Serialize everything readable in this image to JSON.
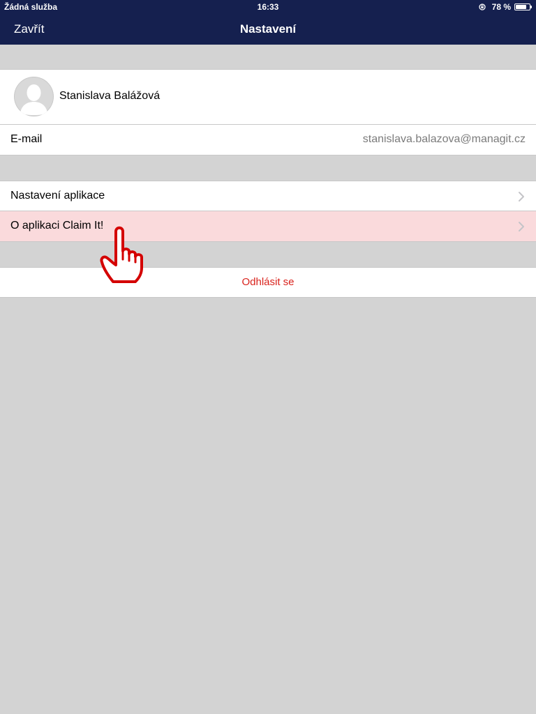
{
  "status_bar": {
    "carrier": "Žádná služba",
    "time": "16:33",
    "battery_percent": "78 %",
    "battery_level": 0.78
  },
  "nav_bar": {
    "close_label": "Zavřít",
    "title": "Nastavení"
  },
  "profile": {
    "name": "Stanislava Balážová",
    "avatar_icon": "person-silhouette-icon"
  },
  "email": {
    "label": "E-mail",
    "value": "stanislava.balazova@managit.cz"
  },
  "menu": {
    "app_settings_label": "Nastavení aplikace",
    "about_label": "O aplikaci Claim It!"
  },
  "logout": {
    "label": "Odhlásit se"
  },
  "colors": {
    "nav_background": "#15204f",
    "page_background": "#d3d3d3",
    "highlight_row": "#fadadc",
    "logout_text": "#d9221c",
    "pointer_outline": "#d40000"
  }
}
